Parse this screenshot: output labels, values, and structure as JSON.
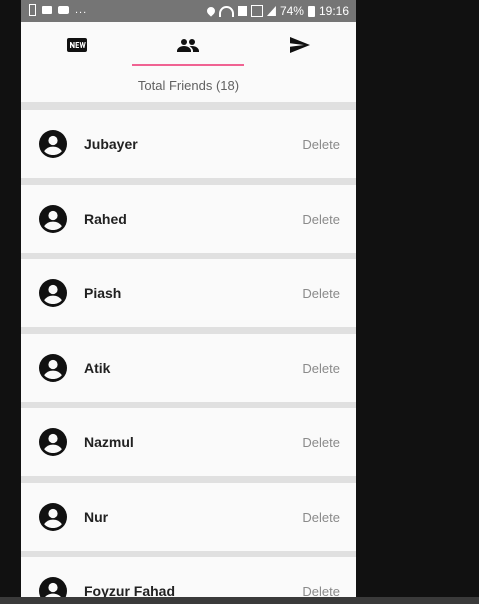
{
  "status_bar": {
    "dots": "...",
    "battery": "74%",
    "time": "19:16"
  },
  "tabs": [
    {
      "icon": "new-badge-icon",
      "active": false
    },
    {
      "icon": "people-icon",
      "active": true
    },
    {
      "icon": "send-icon",
      "active": false
    }
  ],
  "header": {
    "total_friends": "Total Friends (18)"
  },
  "friends": [
    {
      "name": "Jubayer",
      "action": "Delete"
    },
    {
      "name": "Rahed",
      "action": "Delete"
    },
    {
      "name": "Piash",
      "action": "Delete"
    },
    {
      "name": "Atik",
      "action": "Delete"
    },
    {
      "name": "Nazmul",
      "action": "Delete"
    },
    {
      "name": "Nur",
      "action": "Delete"
    },
    {
      "name": "Foyzur Fahad",
      "action": "Delete"
    }
  ],
  "colors": {
    "accent": "#f06292",
    "status_bar": "#757575",
    "background": "#111111"
  }
}
